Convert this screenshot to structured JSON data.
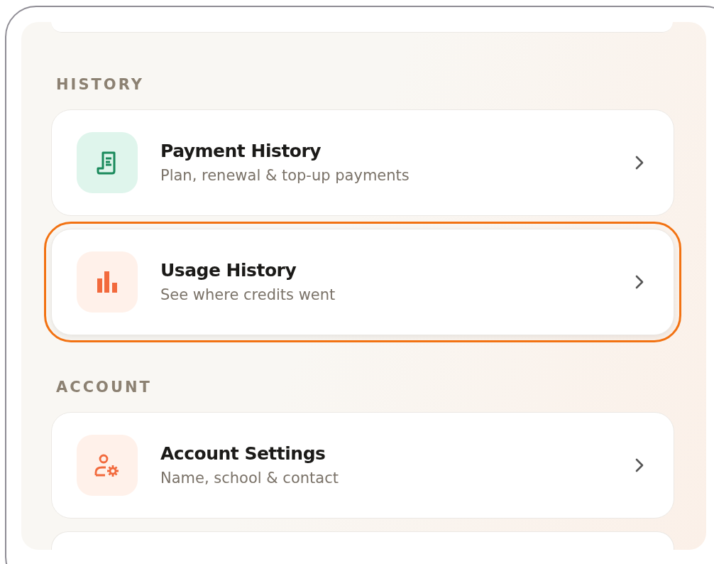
{
  "sections": [
    {
      "title": "HISTORY",
      "items": [
        {
          "kind": "receipt",
          "title": "Payment History",
          "subtitle": "Plan, renewal & top-up payments",
          "selected": false
        },
        {
          "kind": "chart",
          "title": "Usage History",
          "subtitle": "See where credits went",
          "selected": true
        }
      ]
    },
    {
      "title": "ACCOUNT",
      "items": [
        {
          "kind": "user-gear",
          "title": "Account Settings",
          "subtitle": "Name, school & contact",
          "selected": false
        }
      ]
    }
  ]
}
